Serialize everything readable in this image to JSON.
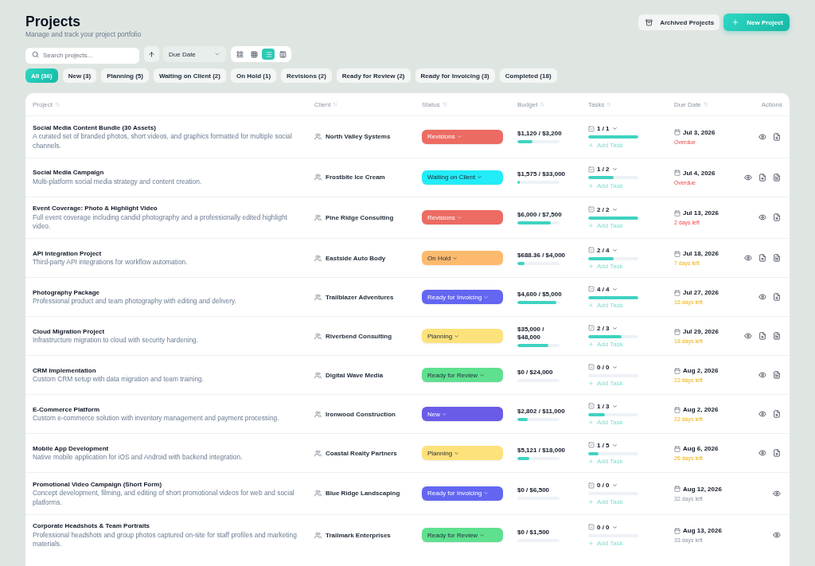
{
  "header": {
    "title": "Projects",
    "subtitle": "Manage and track your project portfolio",
    "actions": [
      {
        "kind": "archive",
        "label": "Archived Projects"
      },
      {
        "kind": "create",
        "label": "New Project"
      }
    ]
  },
  "toolbar": {
    "search": {
      "placeholder": "Search projects..."
    },
    "sort_ascending": true,
    "sort_by": "Due Date",
    "views": [
      {
        "kind": "grid",
        "selected": false
      },
      {
        "kind": "table",
        "selected": false
      },
      {
        "kind": "list",
        "selected": true
      },
      {
        "kind": "board",
        "selected": false
      }
    ]
  },
  "filters": [
    {
      "label": "All (36)",
      "selected": true
    },
    {
      "label": "New (3)",
      "selected": false
    },
    {
      "label": "Planning (5)",
      "selected": false
    },
    {
      "label": "Waiting on Client (2)",
      "selected": false
    },
    {
      "label": "On Hold (1)",
      "selected": false
    },
    {
      "label": "Revisions (2)",
      "selected": false
    },
    {
      "label": "Ready for Review (2)",
      "selected": false
    },
    {
      "label": "Ready for Invoicing (3)",
      "selected": false
    },
    {
      "label": "Completed (18)",
      "selected": false
    }
  ],
  "table": {
    "columns": [
      {
        "label": "Project",
        "sortable": true
      },
      {
        "label": "Client",
        "sortable": true
      },
      {
        "label": "Status",
        "sortable": true
      },
      {
        "label": "Budget",
        "sortable": true
      },
      {
        "label": "Tasks",
        "sortable": true
      },
      {
        "label": "Due Date",
        "sortable": true
      },
      {
        "label": "Actions",
        "sortable": false
      }
    ],
    "rows": [
      {
        "project": {
          "title": "Social Media Content Bundle (30 Assets)",
          "description": "A curated set of branded photos, short videos, and graphics formatted for multiple social channels."
        },
        "client": "North Valley Systems",
        "status": {
          "label": "Revisions",
          "color": "#ec6b63"
        },
        "budget": {
          "amount": "$1,120 / $3,200",
          "level": 0.35
        },
        "tasks": {
          "count": "1 / 1",
          "level": 1,
          "add_label": "Add Task"
        },
        "due": {
          "date": "Jul 3, 2026",
          "note": "Overdue",
          "kind": "urgent"
        },
        "actions": [
          {
            "kind": "view"
          },
          {
            "kind": "add-file"
          }
        ]
      },
      {
        "project": {
          "title": "Social Media Campaign",
          "description": "Multi-platform social media strategy and content creation."
        },
        "client": "Frostbite Ice Cream",
        "status": {
          "label": "Waiting on Client",
          "color": "#22ecf7"
        },
        "budget": {
          "amount": "$1,575 / $33,000",
          "level": 0.05
        },
        "tasks": {
          "count": "1 / 2",
          "level": 0.5,
          "add_label": "Add Task"
        },
        "due": {
          "date": "Jul 4, 2026",
          "note": "Overdue",
          "kind": "urgent"
        },
        "actions": [
          {
            "kind": "view"
          },
          {
            "kind": "add-file"
          },
          {
            "kind": "document"
          }
        ]
      },
      {
        "project": {
          "title": "Event Coverage: Photo & Highlight Video",
          "description": "Full event coverage including candid photography and a professionally edited highlight video."
        },
        "client": "Pine Ridge Consulting",
        "status": {
          "label": "Revisions",
          "color": "#ec6b63"
        },
        "budget": {
          "amount": "$6,000 / $7,500",
          "level": 0.8
        },
        "tasks": {
          "count": "2 / 2",
          "level": 1,
          "add_label": "Add Task"
        },
        "due": {
          "date": "Jul 13, 2026",
          "note": "2 days left",
          "kind": "urgent"
        },
        "actions": [
          {
            "kind": "view"
          },
          {
            "kind": "add-file"
          }
        ]
      },
      {
        "project": {
          "title": "API Integration Project",
          "description": "Third-party API integrations for workflow automation."
        },
        "client": "Eastside Auto Body",
        "status": {
          "label": "On Hold",
          "color": "#fdba6c"
        },
        "budget": {
          "amount": "$688.36 / $4,000",
          "level": 0.17
        },
        "tasks": {
          "count": "2 / 4",
          "level": 0.5,
          "add_label": "Add Task"
        },
        "due": {
          "date": "Jul 18, 2026",
          "note": "7 days left",
          "kind": "soon"
        },
        "actions": [
          {
            "kind": "view"
          },
          {
            "kind": "add-file"
          },
          {
            "kind": "document"
          }
        ]
      },
      {
        "project": {
          "title": "Photography Package",
          "description": "Professional product and team photography with editing and delivery."
        },
        "client": "Trailblazer Adventures",
        "status": {
          "label": "Ready for Invoicing",
          "color": "#6366f1"
        },
        "budget": {
          "amount": "$4,600 / $5,000",
          "level": 0.92
        },
        "tasks": {
          "count": "4 / 4",
          "level": 1,
          "add_label": "Add Task"
        },
        "due": {
          "date": "Jul 27, 2026",
          "note": "16 days left",
          "kind": "soon"
        },
        "actions": [
          {
            "kind": "view"
          },
          {
            "kind": "add-file"
          }
        ]
      },
      {
        "project": {
          "title": "Cloud Migration Project",
          "description": "Infrastructure migration to cloud with security hardening."
        },
        "client": "Riverbend Consulting",
        "status": {
          "label": "Planning",
          "color": "#fde27c"
        },
        "budget": {
          "amount": "$35,000 / $48,000",
          "level": 0.73
        },
        "tasks": {
          "count": "2 / 3",
          "level": 0.67,
          "add_label": "Add Task"
        },
        "due": {
          "date": "Jul 29, 2026",
          "note": "18 days left",
          "kind": "soon"
        },
        "actions": [
          {
            "kind": "view"
          },
          {
            "kind": "add-file"
          },
          {
            "kind": "document"
          }
        ]
      },
      {
        "project": {
          "title": "CRM Implementation",
          "description": "Custom CRM setup with data migration and team training."
        },
        "client": "Digital Wave Media",
        "status": {
          "label": "Ready for Review",
          "color": "#5fe08f"
        },
        "budget": {
          "amount": "$0 / $24,000",
          "level": 0
        },
        "tasks": {
          "count": "0 / 0",
          "level": 0,
          "add_label": "Add Task"
        },
        "due": {
          "date": "Aug 2, 2026",
          "note": "22 days left",
          "kind": "soon"
        },
        "actions": [
          {
            "kind": "view"
          },
          {
            "kind": "document"
          }
        ]
      },
      {
        "project": {
          "title": "E-Commerce Platform",
          "description": "Custom e-commerce solution with inventory management and payment processing."
        },
        "client": "Ironwood Construction",
        "status": {
          "label": "New",
          "color": "#6a5ce8"
        },
        "budget": {
          "amount": "$2,802 / $11,000",
          "level": 0.25
        },
        "tasks": {
          "count": "1 / 3",
          "level": 0.33,
          "add_label": "Add Task"
        },
        "due": {
          "date": "Aug 2, 2026",
          "note": "22 days left",
          "kind": "soon"
        },
        "actions": [
          {
            "kind": "view"
          },
          {
            "kind": "add-file"
          }
        ]
      },
      {
        "project": {
          "title": "Mobile App Development",
          "description": "Native mobile application for iOS and Android with backend integration."
        },
        "client": "Coastal Realty Partners",
        "status": {
          "label": "Planning",
          "color": "#fde27c"
        },
        "budget": {
          "amount": "$5,121 / $18,000",
          "level": 0.28
        },
        "tasks": {
          "count": "1 / 5",
          "level": 0.2,
          "add_label": "Add Task"
        },
        "due": {
          "date": "Aug 6, 2026",
          "note": "26 days left",
          "kind": "soon"
        },
        "actions": [
          {
            "kind": "view"
          },
          {
            "kind": "add-file"
          }
        ]
      },
      {
        "project": {
          "title": "Promotional Video Campaign (Short Form)",
          "description": "Concept development, filming, and editing of short promotional videos for web and social platforms."
        },
        "client": "Blue Ridge Landscaping",
        "status": {
          "label": "Ready for Invoicing",
          "color": "#6366f1"
        },
        "budget": {
          "amount": "$0 / $6,500",
          "level": 0
        },
        "tasks": {
          "count": "0 / 0",
          "level": 0,
          "add_label": "Add Task"
        },
        "due": {
          "date": "Aug 12, 2026",
          "note": "32 days left",
          "kind": "later"
        },
        "actions": [
          {
            "kind": "view"
          }
        ]
      },
      {
        "project": {
          "title": "Corporate Headshots & Team Portraits",
          "description": "Professional headshots and group photos captured on-site for staff profiles and marketing materials."
        },
        "client": "Trailmark Enterprises",
        "status": {
          "label": "Ready for Review",
          "color": "#5fe08f"
        },
        "budget": {
          "amount": "$0 / $1,500",
          "level": 0
        },
        "tasks": {
          "count": "0 / 0",
          "level": 0,
          "add_label": "Add Task"
        },
        "due": {
          "date": "Aug 13, 2026",
          "note": "33 days left",
          "kind": "later"
        },
        "actions": [
          {
            "kind": "view"
          }
        ]
      }
    ]
  }
}
